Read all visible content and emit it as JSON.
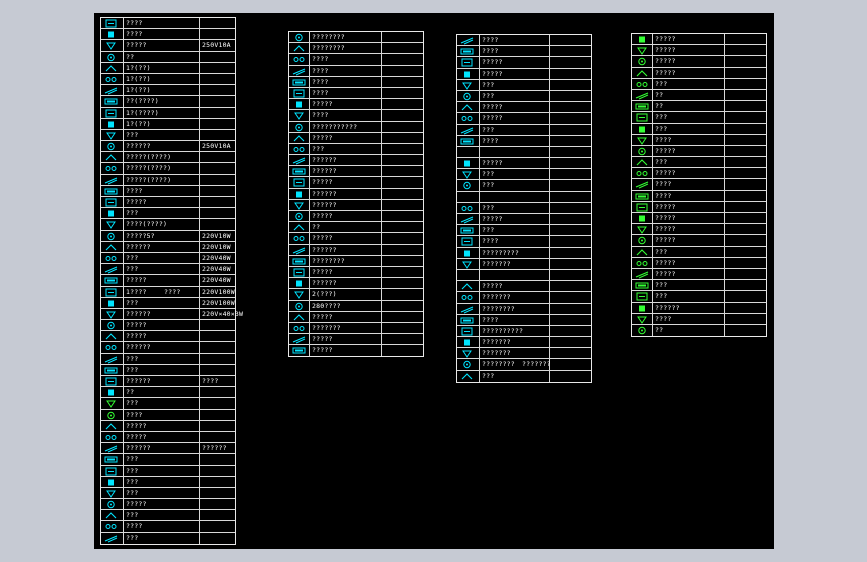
{
  "colors": {
    "background": "#c6cad3",
    "canvas": "#000000",
    "grid": "#e8e8e8",
    "symbol_cyan": "#00e5ff",
    "symbol_green": "#33ff33",
    "marker_red": "#ff2020",
    "text": "#ffffff"
  },
  "legend_tables": [
    {
      "id": "table-1",
      "rows": [
        {
          "icon": "cyan-glyph-icon",
          "t1": "????",
          "t2": ""
        },
        {
          "icon": "cyan-glyph-icon",
          "t1": "????",
          "t2": ""
        },
        {
          "icon": "cyan-glyph-icon",
          "t1": "?????",
          "t2": "250V10A"
        },
        {
          "icon": "cyan-glyph-icon",
          "t1": "??",
          "t2": ""
        },
        {
          "icon": "cyan-glyph-icon",
          "t1": "1?(??)",
          "t2": ""
        },
        {
          "icon": "cyan-glyph-icon",
          "t1": "1?(??)",
          "t2": ""
        },
        {
          "icon": "cyan-glyph-icon",
          "t1": "1?(??)",
          "t2": ""
        },
        {
          "icon": "cyan-glyph-icon",
          "t1": "??(????)",
          "t2": ""
        },
        {
          "icon": "cyan-glyph-icon",
          "t1": "1?(????)",
          "t2": ""
        },
        {
          "icon": "cyan-glyph-icon",
          "t1": "1?(??)",
          "t2": ""
        },
        {
          "icon": "cyan-glyph-icon",
          "t1": "???",
          "t2": ""
        },
        {
          "icon": "cyan-glyph-icon",
          "t1": "??????",
          "t2": "250V10A"
        },
        {
          "icon": "cyan-glyph-icon",
          "t1": "?????(????)",
          "t2": ""
        },
        {
          "icon": "cyan-glyph-icon",
          "t1": "?????(????)",
          "t2": ""
        },
        {
          "icon": "cyan-glyph-icon",
          "t1": "?????(????)",
          "t2": ""
        },
        {
          "icon": "cyan-glyph-icon",
          "t1": "????",
          "t2": ""
        },
        {
          "icon": "cyan-glyph-icon",
          "t1": "?????",
          "t2": ""
        },
        {
          "icon": "cyan-glyph-icon",
          "t1": "???",
          "t2": ""
        },
        {
          "icon": "cyan-glyph-icon",
          "t1": "????(????)",
          "t2": ""
        },
        {
          "icon": "cyan-glyph-icon",
          "t1": "?????5?",
          "t2": "220V10W"
        },
        {
          "icon": "cyan-glyph-icon",
          "t1": "??????",
          "t2": "220V10W"
        },
        {
          "icon": "cyan-glyph-icon",
          "t1": "???",
          "t2": "220V40W"
        },
        {
          "icon": "cyan-glyph-icon",
          "t1": "???",
          "t2": "220V40W"
        },
        {
          "icon": "cyan-glyph-icon",
          "t1": "?????",
          "t2": "220V40W"
        },
        {
          "icon": "cyan-glyph-icon",
          "t1": "1????",
          "t2": "220V100W",
          "t3": "????"
        },
        {
          "icon": "cyan-glyph-icon",
          "t1": "???",
          "t2": "220V100W"
        },
        {
          "icon": "cyan-glyph-icon",
          "t1": "??????",
          "t2": "220V×40×3W"
        },
        {
          "icon": "cyan-glyph-icon",
          "t1": "?????",
          "t2": ""
        },
        {
          "icon": "cyan-glyph-icon",
          "t1": "?????",
          "t2": ""
        },
        {
          "icon": "cyan-glyph-icon",
          "t1": "??????",
          "t2": ""
        },
        {
          "icon": "cyan-glyph-icon",
          "t1": "???",
          "t2": ""
        },
        {
          "icon": "cyan-glyph-icon",
          "t1": "???",
          "t2": ""
        },
        {
          "icon": "cyan-glyph-icon",
          "t1": "??????",
          "t2": "????"
        },
        {
          "icon": "cyan-glyph-icon",
          "t1": "??",
          "t2": ""
        },
        {
          "icon": "green-glyph-icon",
          "t1": "???",
          "t2": ""
        },
        {
          "icon": "green-glyph-icon",
          "t1": "????",
          "t2": ""
        },
        {
          "icon": "cyan-glyph-icon",
          "t1": "?????",
          "t2": ""
        },
        {
          "icon": "cyan-glyph-icon",
          "t1": "?????",
          "t2": ""
        },
        {
          "icon": "cyan-glyph-icon",
          "t1": "??????",
          "t2": "??????"
        },
        {
          "icon": "cyan-glyph-icon",
          "t1": "???",
          "t2": ""
        },
        {
          "icon": "cyan-glyph-icon",
          "t1": "???",
          "t2": ""
        },
        {
          "icon": "cyan-glyph-icon",
          "t1": "???",
          "t2": ""
        },
        {
          "icon": "cyan-glyph-icon",
          "t1": "???",
          "t2": ""
        },
        {
          "icon": "cyan-glyph-icon",
          "t1": "?????",
          "t2": ""
        },
        {
          "icon": "cyan-glyph-icon",
          "t1": "???",
          "t2": ""
        },
        {
          "icon": "cyan-glyph-icon",
          "t1": "????",
          "t2": ""
        },
        {
          "icon": "cyan-glyph-icon",
          "t1": "???",
          "t2": ""
        }
      ]
    },
    {
      "id": "table-2",
      "rows": [
        {
          "icon": "cyan-glyph-icon",
          "t1": "????????",
          "t2": ""
        },
        {
          "icon": "cyan-glyph-icon",
          "t1": "????????",
          "t2": ""
        },
        {
          "icon": "cyan-glyph-icon",
          "t1": "????",
          "t2": ""
        },
        {
          "icon": "cyan-glyph-icon",
          "t1": "????",
          "t2": ""
        },
        {
          "icon": "cyan-glyph-icon",
          "t1": "????",
          "t2": ""
        },
        {
          "icon": "cyan-glyph-icon",
          "t1": "????",
          "t2": ""
        },
        {
          "icon": "cyan-glyph-icon",
          "t1": "?????",
          "t2": ""
        },
        {
          "icon": "cyan-glyph-icon",
          "t1": "????",
          "t2": ""
        },
        {
          "icon": "cyan-glyph-icon",
          "t1": "???????????",
          "t2": ""
        },
        {
          "icon": "cyan-glyph-icon",
          "t1": "?????",
          "t2": ""
        },
        {
          "icon": "cyan-glyph-icon",
          "t1": "???",
          "t2": ""
        },
        {
          "icon": "cyan-glyph-icon",
          "t1": "??????",
          "t2": ""
        },
        {
          "icon": "cyan-glyph-icon",
          "t1": "??????",
          "t2": ""
        },
        {
          "icon": "cyan-glyph-icon",
          "t1": "?????",
          "t2": ""
        },
        {
          "icon": "cyan-glyph-icon",
          "t1": "??????",
          "t2": ""
        },
        {
          "icon": "cyan-glyph-icon",
          "t1": "??????",
          "t2": ""
        },
        {
          "icon": "cyan-glyph-icon",
          "t1": "?????",
          "t2": ""
        },
        {
          "icon": "cyan-glyph-icon",
          "t1": "??",
          "t2": ""
        },
        {
          "icon": "cyan-glyph-icon",
          "t1": "?????",
          "t2": ""
        },
        {
          "icon": "cyan-glyph-icon",
          "t1": "??????",
          "t2": ""
        },
        {
          "icon": "cyan-glyph-icon",
          "t1": "????????",
          "t2": ""
        },
        {
          "icon": "cyan-glyph-icon",
          "t1": "?????",
          "t2": ""
        },
        {
          "icon": "cyan-glyph-icon",
          "t1": "??????",
          "t2": ""
        },
        {
          "icon": "cyan-glyph-icon",
          "t1": "2(???)",
          "t2": ""
        },
        {
          "icon": "cyan-glyph-icon",
          "t1": "280????",
          "t2": ""
        },
        {
          "icon": "cyan-glyph-icon",
          "t1": "?????",
          "t2": ""
        },
        {
          "icon": "cyan-glyph-icon",
          "t1": "???????",
          "t2": ""
        },
        {
          "icon": "cyan-glyph-icon",
          "t1": "?????",
          "t2": ""
        },
        {
          "icon": "cyan-glyph-icon",
          "t1": "?????",
          "t2": ""
        }
      ]
    },
    {
      "id": "table-3",
      "rows": [
        {
          "icon": "cyan-glyph-icon",
          "t1": "????",
          "t2": ""
        },
        {
          "icon": "cyan-glyph-icon",
          "t1": "????",
          "t2": ""
        },
        {
          "icon": "cyan-glyph-icon",
          "t1": "?????",
          "t2": ""
        },
        {
          "icon": "cyan-glyph-icon",
          "t1": "?????",
          "t2": ""
        },
        {
          "icon": "cyan-glyph-icon",
          "t1": "???",
          "t2": ""
        },
        {
          "icon": "cyan-glyph-icon",
          "t1": "???",
          "t2": ""
        },
        {
          "icon": "cyan-glyph-icon",
          "t1": "?????",
          "t2": ""
        },
        {
          "icon": "cyan-glyph-icon",
          "t1": "?????",
          "t2": ""
        },
        {
          "icon": "cyan-glyph-icon",
          "t1": "???",
          "t2": ""
        },
        {
          "icon": "cyan-glyph-icon",
          "t1": "????",
          "t2": ""
        },
        {
          "icon": "empty",
          "t1": "",
          "t2": ""
        },
        {
          "icon": "cyan-glyph-icon",
          "t1": "?????",
          "t2": ""
        },
        {
          "icon": "cyan-glyph-icon",
          "t1": "???",
          "t2": ""
        },
        {
          "icon": "cyan-glyph-icon",
          "t1": "???",
          "t2": ""
        },
        {
          "icon": "empty",
          "t1": "",
          "t2": ""
        },
        {
          "icon": "cyan-glyph-icon",
          "t1": "???",
          "t2": ""
        },
        {
          "icon": "cyan-glyph-icon",
          "t1": "?????",
          "t2": ""
        },
        {
          "icon": "cyan-glyph-icon",
          "t1": "???",
          "t2": ""
        },
        {
          "icon": "cyan-glyph-icon",
          "t1": "????",
          "t2": ""
        },
        {
          "icon": "cyan-glyph-icon",
          "t1": "?????????",
          "t2": ""
        },
        {
          "icon": "cyan-glyph-icon",
          "t1": "???????",
          "t2": ""
        },
        {
          "icon": "empty",
          "t1": "",
          "t2": ""
        },
        {
          "icon": "cyan-glyph-icon",
          "t1": "?????",
          "t2": ""
        },
        {
          "icon": "cyan-glyph-icon",
          "t1": "???????",
          "t2": ""
        },
        {
          "icon": "cyan-glyph-icon",
          "t1": "????????",
          "t2": ""
        },
        {
          "icon": "cyan-glyph-icon",
          "t1": "????",
          "t2": ""
        },
        {
          "icon": "cyan-glyph-icon",
          "t1": "??????????",
          "t2": ""
        },
        {
          "icon": "cyan-glyph-icon",
          "t1": "???????",
          "t2": ""
        },
        {
          "icon": "cyan-glyph-icon",
          "t1": "???????",
          "t2": ""
        },
        {
          "icon": "cyan-glyph-icon",
          "t1": "????????",
          "t2": "???????"
        },
        {
          "icon": "cyan-glyph-icon",
          "t1": "???",
          "t2": ""
        }
      ]
    },
    {
      "id": "table-4",
      "rows": [
        {
          "icon": "green-glyph-icon",
          "t1": "?????",
          "t2": ""
        },
        {
          "icon": "green-glyph-icon",
          "t1": "?????",
          "t2": ""
        },
        {
          "icon": "green-glyph-icon",
          "t1": "?????",
          "t2": ""
        },
        {
          "icon": "green-glyph-icon",
          "t1": "?????",
          "t2": ""
        },
        {
          "icon": "green-glyph-icon",
          "t1": "???",
          "t2": ""
        },
        {
          "icon": "green-glyph-icon",
          "t1": "??",
          "t2": ""
        },
        {
          "icon": "green-glyph-icon",
          "t1": "??",
          "t2": ""
        },
        {
          "icon": "green-glyph-icon",
          "t1": "???",
          "t2": ""
        },
        {
          "icon": "green-glyph-icon",
          "t1": "???",
          "t2": ""
        },
        {
          "icon": "green-glyph-icon",
          "t1": "????",
          "t2": ""
        },
        {
          "icon": "green-glyph-icon",
          "t1": "?????",
          "t2": ""
        },
        {
          "icon": "green-glyph-icon",
          "t1": "???",
          "t2": ""
        },
        {
          "icon": "green-glyph-icon",
          "t1": "?????",
          "t2": ""
        },
        {
          "icon": "green-glyph-icon",
          "t1": "????",
          "t2": ""
        },
        {
          "icon": "green-glyph-icon",
          "t1": "????",
          "t2": ""
        },
        {
          "icon": "green-glyph-icon",
          "t1": "?????",
          "t2": ""
        },
        {
          "icon": "green-glyph-icon",
          "t1": "?????",
          "t2": ""
        },
        {
          "icon": "green-glyph-icon",
          "t1": "?????",
          "t2": ""
        },
        {
          "icon": "green-glyph-icon",
          "t1": "?????",
          "t2": ""
        },
        {
          "icon": "green-glyph-icon",
          "t1": "???",
          "t2": ""
        },
        {
          "icon": "green-glyph-icon",
          "t1": "?????",
          "t2": ""
        },
        {
          "icon": "green-glyph-icon",
          "t1": "?????",
          "t2": ""
        },
        {
          "icon": "green-glyph-icon",
          "t1": "???",
          "t2": ""
        },
        {
          "icon": "green-glyph-icon",
          "t1": "???",
          "t2": ""
        },
        {
          "icon": "green-glyph-icon",
          "t1": "??????",
          "t2": ""
        },
        {
          "icon": "green-glyph-icon",
          "t1": "????",
          "t2": ""
        },
        {
          "icon": "green-glyph-icon",
          "t1": "??",
          "t2": ""
        }
      ]
    }
  ]
}
